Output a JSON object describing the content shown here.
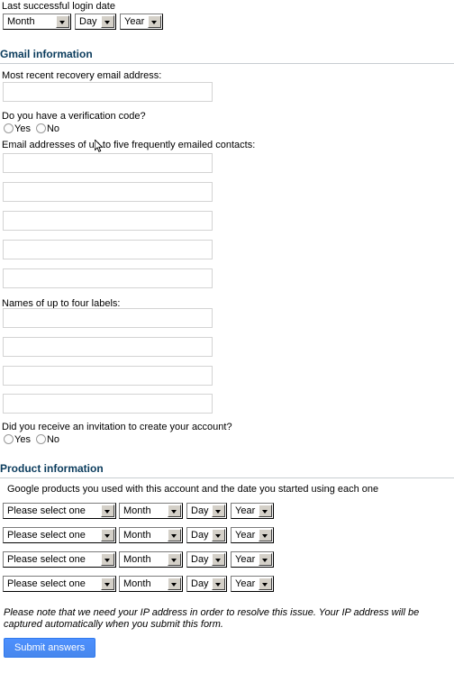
{
  "login_date": {
    "label": "Last successful login date",
    "month": "Month",
    "day": "Day",
    "year": "Year"
  },
  "gmail_section": {
    "heading": "Gmail information",
    "recovery_label": "Most recent recovery email address:",
    "recovery_value": "",
    "verification_question": "Do you have a verification code?",
    "yes_label": "Yes",
    "no_label": "No",
    "contacts_label": "Email addresses of up to five frequently emailed contacts:",
    "contacts": [
      "",
      "",
      "",
      "",
      ""
    ],
    "labels_label": "Names of up to four labels:",
    "labels": [
      "",
      "",
      "",
      ""
    ],
    "invitation_question": "Did you receive an invitation to create your account?",
    "invitation_yes": "Yes",
    "invitation_no": "No"
  },
  "product_section": {
    "heading": "Product information",
    "description": "Google products you used with this account and the date you started using each one",
    "rows": [
      {
        "product": "Please select one",
        "month": "Month",
        "day": "Day",
        "year": "Year"
      },
      {
        "product": "Please select one",
        "month": "Month",
        "day": "Day",
        "year": "Year"
      },
      {
        "product": "Please select one",
        "month": "Month",
        "day": "Day",
        "year": "Year"
      },
      {
        "product": "Please select one",
        "month": "Month",
        "day": "Day",
        "year": "Year"
      }
    ]
  },
  "footer": {
    "note": "Please note that we need your IP address in order to resolve this issue. Your IP address will be captured automatically when you submit this form.",
    "submit_label": "Submit answers"
  },
  "colors": {
    "heading": "#0b3c5d",
    "heading_rule": "#c8cdd1",
    "submit_bg": "#4787ed",
    "submit_border": "#3079ed",
    "input_border": "#d3d3d3"
  }
}
